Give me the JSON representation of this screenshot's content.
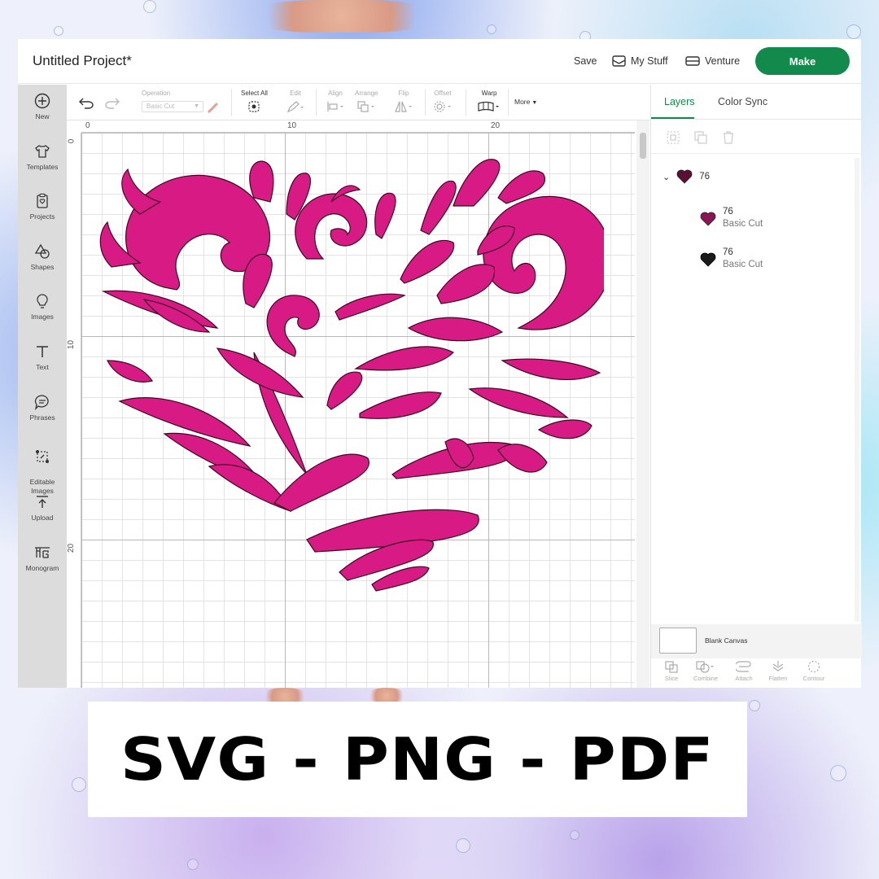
{
  "app": {
    "title": "Untitled Project*",
    "save_label": "Save",
    "mystuff_label": "My Stuff",
    "venture_label": "Venture",
    "make_label": "Make",
    "accent_color": "#118a4c"
  },
  "sidebar": {
    "items": [
      {
        "label": "New",
        "icon": "plus-circle-icon"
      },
      {
        "label": "Templates",
        "icon": "tshirt-icon"
      },
      {
        "label": "Projects",
        "icon": "clipboard-icon"
      },
      {
        "label": "Shapes",
        "icon": "shapes-icon"
      },
      {
        "label": "Images",
        "icon": "lightbulb-icon"
      },
      {
        "label": "Text",
        "icon": "text-icon"
      },
      {
        "label": "Phrases",
        "icon": "speech-bubble-icon"
      },
      {
        "label": "Editable\nImages",
        "icon": "editable-images-icon"
      },
      {
        "label": "Upload",
        "icon": "upload-icon"
      },
      {
        "label": "Monogram",
        "icon": "monogram-icon"
      }
    ]
  },
  "toolbar": {
    "operation_label": "Operation",
    "operation_value": "Basic Cut",
    "select_all_label": "Select All",
    "edit_label": "Edit",
    "align_label": "Align",
    "arrange_label": "Arrange",
    "flip_label": "Flip",
    "offset_label": "Offset",
    "warp_label": "Warp",
    "more_label": "More"
  },
  "ruler": {
    "top_ticks": [
      "0",
      "10",
      "20"
    ],
    "left_ticks": [
      "0",
      "10",
      "20"
    ]
  },
  "layers_panel": {
    "tab_layers": "Layers",
    "tab_color_sync": "Color Sync",
    "group": {
      "name": "76"
    },
    "children": [
      {
        "name": "76",
        "operation": "Basic Cut",
        "color": "#c2185b"
      },
      {
        "name": "76",
        "operation": "Basic Cut",
        "color": "#1a1a1a"
      }
    ],
    "blank_canvas_label": "Blank Canvas",
    "bottom_buttons": [
      "Slice",
      "Combine",
      "Attach",
      "Flatten",
      "Contour"
    ]
  },
  "design": {
    "fill_color": "#d81b84",
    "shape": "swirl-heart"
  },
  "banner": {
    "text": "SVG - PNG - PDF"
  }
}
